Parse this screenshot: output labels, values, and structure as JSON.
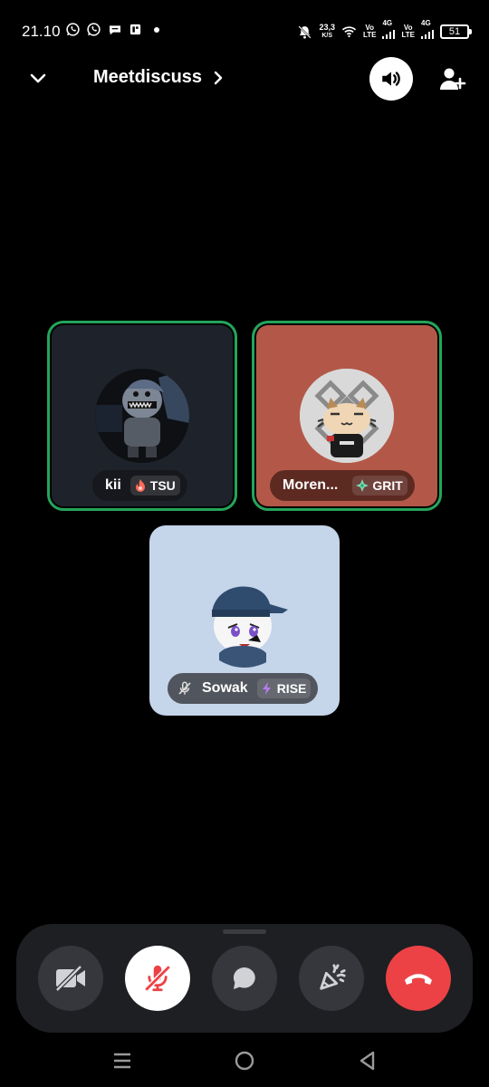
{
  "status_bar": {
    "time": "21.10",
    "net_speed_value": "23,3",
    "net_speed_unit": "K/S",
    "sim1_label_top": "Vo",
    "sim1_label_bottom": "LTE",
    "sim1_network": "4G",
    "sim2_label_top": "Vo",
    "sim2_label_bottom": "LTE",
    "sim2_network": "4G",
    "battery": "51",
    "icons": [
      "whatsapp-icon",
      "whatsapp-icon",
      "chat-bubble-icon",
      "app-icon",
      "dot-icon",
      "bell-off-icon",
      "wifi-icon",
      "signal-icon",
      "signal-icon",
      "battery-icon"
    ]
  },
  "header": {
    "title": "Meetdiscuss",
    "icons": [
      "chevron-down-icon",
      "chevron-right-icon",
      "speaker-icon",
      "add-user-icon"
    ]
  },
  "participants": [
    {
      "name": "kii",
      "tag": "TSU",
      "tag_icon": "flame-icon",
      "speaking": true,
      "muted": false,
      "tile_color": "#1e232b"
    },
    {
      "name": "Moren...",
      "tag": "GRIT",
      "tag_icon": "sparkle-icon",
      "speaking": true,
      "muted": false,
      "tile_color": "#b35848"
    },
    {
      "name": "Sowak",
      "tag": "RISE",
      "tag_icon": "bolt-icon",
      "speaking": false,
      "muted": true,
      "tile_color": "#c5d5ea"
    }
  ],
  "controls": {
    "icons": [
      "video-off-icon",
      "mic-off-icon",
      "chat-icon",
      "activities-icon",
      "end-call-icon"
    ],
    "end_call_color": "#ed4245",
    "speaking_ring_color": "#23a55a"
  },
  "nav_bar": {
    "icons": [
      "menu-icon",
      "home-icon",
      "back-icon"
    ]
  }
}
